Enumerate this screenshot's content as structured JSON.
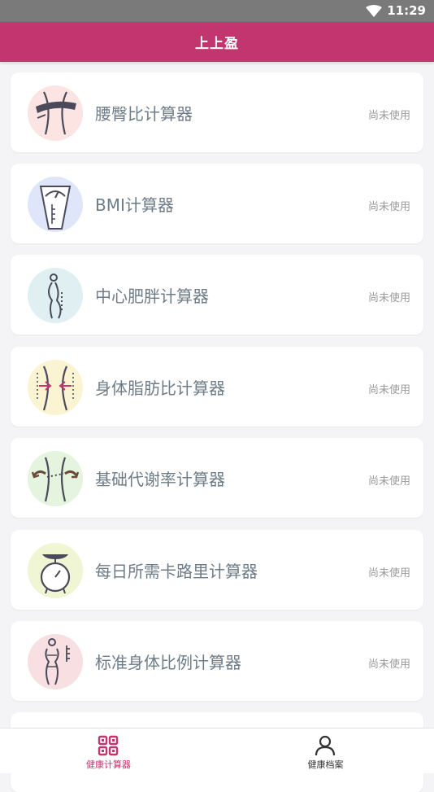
{
  "status_bar": {
    "time": "11:29"
  },
  "header": {
    "title": "上上盈"
  },
  "calculators": [
    {
      "label": "腰臀比计算器",
      "status": "尚未使用",
      "icon": "waist-tape-icon",
      "bg": "#fbe4e2"
    },
    {
      "label": "BMI计算器",
      "status": "尚未使用",
      "icon": "scale-gauge-icon",
      "bg": "#dfe6f9"
    },
    {
      "label": "中心肥胖计算器",
      "status": "尚未使用",
      "icon": "body-profile-icon",
      "bg": "#e0eff1"
    },
    {
      "label": "身体脂肪比计算器",
      "status": "尚未使用",
      "icon": "waist-arrows-icon",
      "bg": "#fbf4d3"
    },
    {
      "label": "基础代谢率计算器",
      "status": "尚未使用",
      "icon": "waist-rotate-icon",
      "bg": "#e5f4de"
    },
    {
      "label": "每日所需卡路里计算器",
      "status": "尚未使用",
      "icon": "kitchen-scale-icon",
      "bg": "#f0f5d3"
    },
    {
      "label": "标准身体比例计算器",
      "status": "尚未使用",
      "icon": "body-ruler-icon",
      "bg": "#f8dfe1"
    }
  ],
  "tabbar": {
    "tabs": [
      {
        "label": "健康计算器",
        "active": true,
        "color": "#c2356f"
      },
      {
        "label": "健康档案",
        "active": false,
        "color": "#333333"
      }
    ]
  },
  "colors": {
    "accent": "#c2356f",
    "icon_stroke": "#4a4a5a"
  }
}
